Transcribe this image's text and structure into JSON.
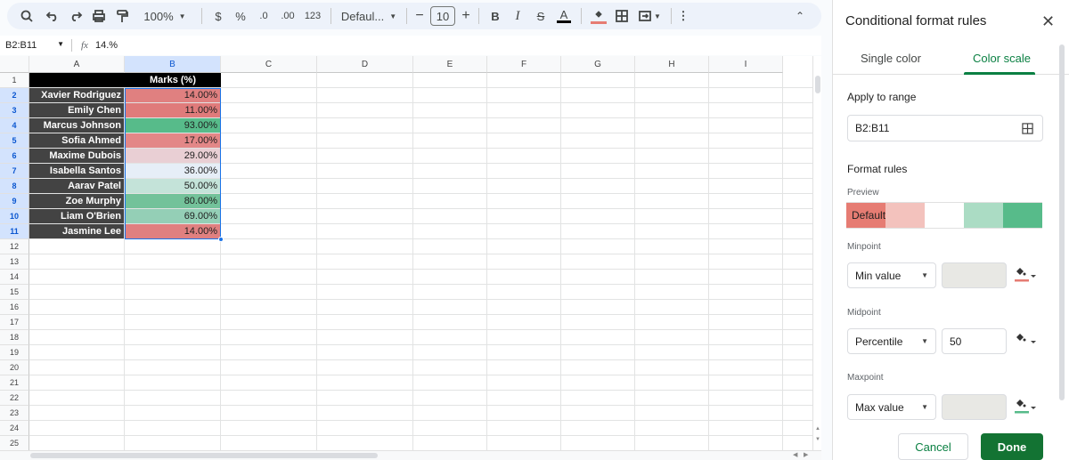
{
  "toolbar": {
    "zoom": "100%",
    "currency": "$",
    "percent": "%",
    "decrease_decimal": ".0",
    "increase_decimal": ".00",
    "number_format": "123",
    "font": "Defaul...",
    "font_size": "10",
    "bold": "B",
    "italic": "I",
    "strike": "S",
    "text_color": "A"
  },
  "formula_bar": {
    "name_box": "B2:B11",
    "fx": "fx",
    "value": "14.%"
  },
  "columns": [
    "A",
    "B",
    "C",
    "D",
    "E",
    "F",
    "G",
    "H",
    "I"
  ],
  "header_cell": "Marks (%)",
  "rows": [
    {
      "name": "Xavier Rodriguez",
      "mark": "14.00%",
      "color": "#e08080"
    },
    {
      "name": "Emily Chen",
      "mark": "11.00%",
      "color": "#e07b7b"
    },
    {
      "name": "Marcus Johnson",
      "mark": "93.00%",
      "color": "#57bb8a"
    },
    {
      "name": "Sofia Ahmed",
      "mark": "17.00%",
      "color": "#e38787"
    },
    {
      "name": "Maxime Dubois",
      "mark": "29.00%",
      "color": "#e9cfd4"
    },
    {
      "name": "Isabella Santos",
      "mark": "36.00%",
      "color": "#e6eef7"
    },
    {
      "name": "Aarav Patel",
      "mark": "50.00%",
      "color": "#c4e3d9"
    },
    {
      "name": "Zoe Murphy",
      "mark": "80.00%",
      "color": "#73c29a"
    },
    {
      "name": "Liam O'Brien",
      "mark": "69.00%",
      "color": "#94cfb6"
    },
    {
      "name": "Jasmine Lee",
      "mark": "14.00%",
      "color": "#e08080"
    }
  ],
  "row_numbers": [
    "1",
    "2",
    "3",
    "4",
    "5",
    "6",
    "7",
    "8",
    "9",
    "10",
    "11",
    "12",
    "13",
    "14",
    "15",
    "16",
    "17",
    "18",
    "19",
    "20",
    "21",
    "22",
    "23",
    "24",
    "25"
  ],
  "panel": {
    "title": "Conditional format rules",
    "tab_single": "Single color",
    "tab_scale": "Color scale",
    "apply_label": "Apply to range",
    "range": "B2:B11",
    "format_rules": "Format rules",
    "preview": "Preview",
    "preview_default": "Default",
    "preview_colors": [
      "#e67c73",
      "#f3c2bd",
      "#ffffff",
      "#abdcc4",
      "#57bb8a"
    ],
    "minpoint_label": "Minpoint",
    "minpoint_type": "Min value",
    "minpoint_color": "#e67c73",
    "midpoint_label": "Midpoint",
    "midpoint_type": "Percentile",
    "midpoint_value": "50",
    "maxpoint_label": "Maxpoint",
    "maxpoint_type": "Max value",
    "maxpoint_color": "#57bb8a",
    "cancel": "Cancel",
    "done": "Done"
  }
}
